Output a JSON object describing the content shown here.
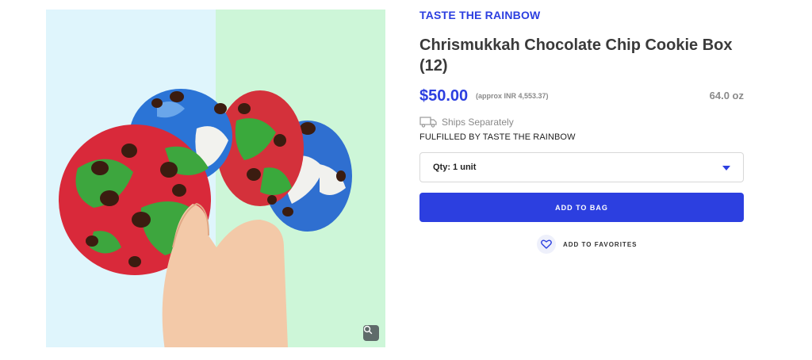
{
  "product": {
    "image_alt": "Rainbow chocolate chip cookies held in a hand",
    "brand": "TASTE THE RAINBOW",
    "title": "Chrismukkah Chocolate Chip Cookie Box (12)",
    "price": "$50.00",
    "price_approx": "(approx INR 4,553.37)",
    "weight": "64.0 oz",
    "shipping_note": "Ships Separately",
    "fulfilled_by": "FULFILLED BY TASTE THE RAINBOW"
  },
  "quantity": {
    "selected": "Qty: 1 unit"
  },
  "actions": {
    "add_to_bag": "ADD TO BAG",
    "add_to_favorites": "ADD TO FAVORITES"
  },
  "icons": {
    "zoom": "magnifier-icon",
    "truck": "truck-icon",
    "heart": "heart-icon",
    "caret": "caret-down-icon"
  },
  "colors": {
    "accent": "#2c3fe0",
    "image_bg_left": "#dff5fc",
    "image_bg_right": "#cdf6d8"
  }
}
